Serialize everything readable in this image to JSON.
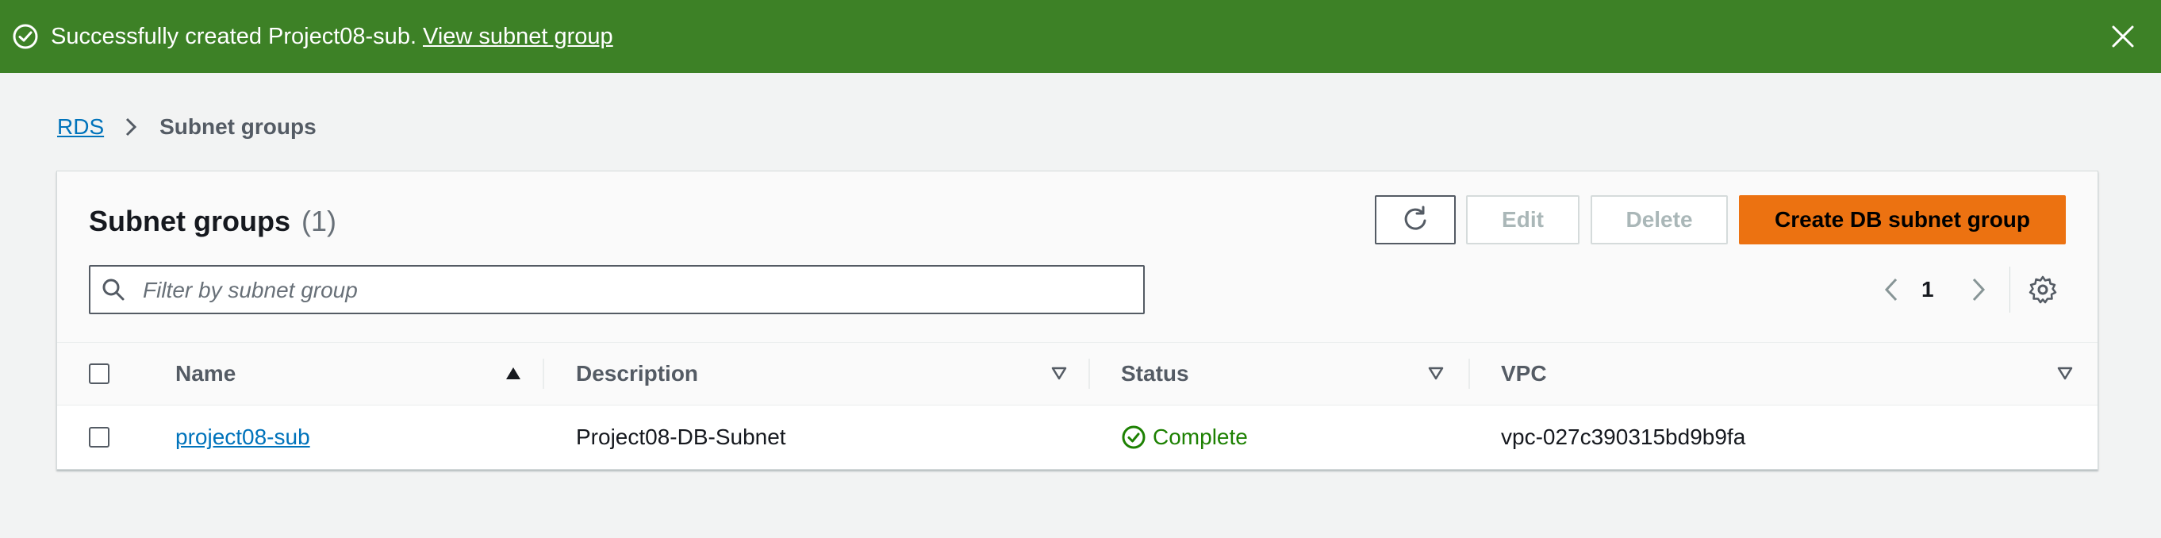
{
  "flash": {
    "message": "Successfully created Project08-sub.",
    "link_label": "View subnet group",
    "color": "#3d8126"
  },
  "breadcrumb": {
    "items": [
      {
        "label": "RDS"
      },
      {
        "label": "Subnet groups"
      }
    ]
  },
  "panel": {
    "title": "Subnet groups",
    "count": "(1)",
    "buttons": {
      "refresh_icon": "refresh-icon",
      "edit": "Edit",
      "delete": "Delete",
      "create": "Create DB subnet group"
    },
    "search": {
      "placeholder": "Filter by subnet group",
      "value": ""
    },
    "pagination": {
      "current_page": "1"
    }
  },
  "table": {
    "columns": [
      {
        "label": "Name",
        "sort": "ascending"
      },
      {
        "label": "Description",
        "sort": "none"
      },
      {
        "label": "Status",
        "sort": "none"
      },
      {
        "label": "VPC",
        "sort": "none"
      }
    ],
    "rows": [
      {
        "name": "project08-sub",
        "description": "Project08-DB-Subnet",
        "status": "Complete",
        "vpc": "vpc-027c390315bd9b9fa"
      }
    ]
  },
  "colors": {
    "accent": "#ec7211",
    "link": "#0073bb",
    "success": "#1d8102"
  }
}
